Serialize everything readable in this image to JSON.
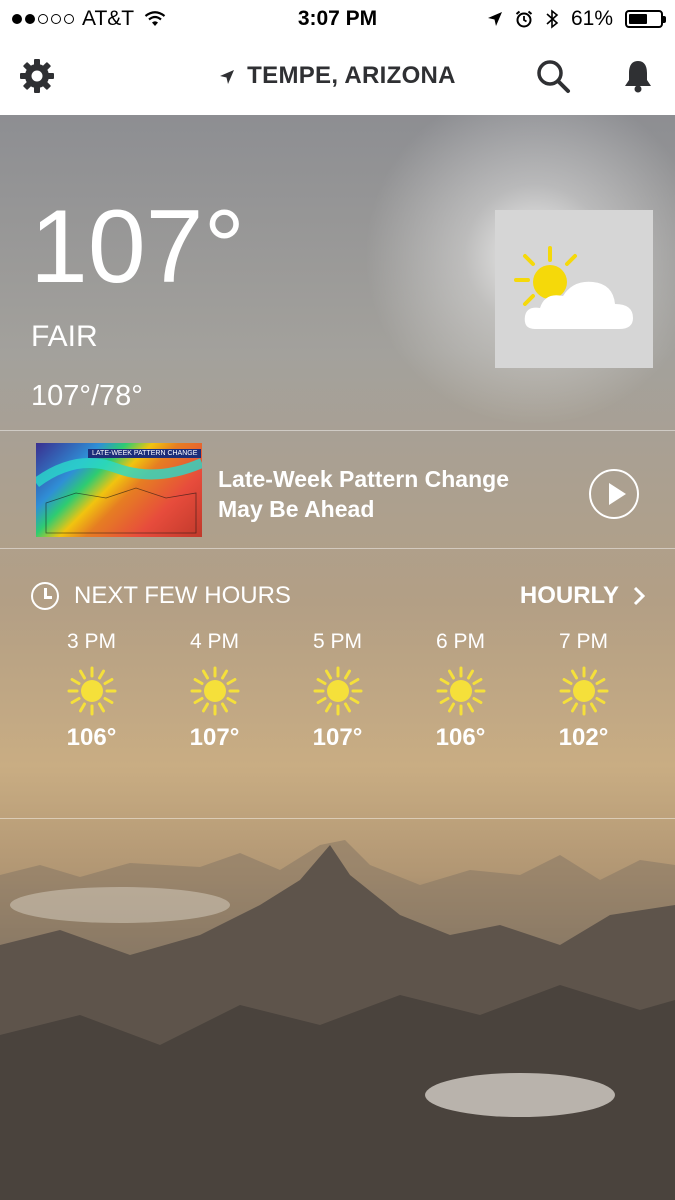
{
  "status_bar": {
    "carrier": "AT&T",
    "time": "3:07 PM",
    "battery": "61%",
    "battery_level": 0.61
  },
  "nav": {
    "location": "TEMPE, ARIZONA"
  },
  "current": {
    "temperature": "107°",
    "condition": "FAIR",
    "hi_lo": "107°/78°",
    "icon": "partly-sunny-icon"
  },
  "video": {
    "title": "Late-Week Pattern Change May Be Ahead",
    "thumbnail_caption": "LATE-WEEK PATTERN CHANGE"
  },
  "forecast": {
    "header": "NEXT FEW HOURS",
    "link": "HOURLY",
    "hours": [
      {
        "time": "3 PM",
        "temp": "106°",
        "icon": "sun-icon"
      },
      {
        "time": "4 PM",
        "temp": "107°",
        "icon": "sun-icon"
      },
      {
        "time": "5 PM",
        "temp": "107°",
        "icon": "sun-icon"
      },
      {
        "time": "6 PM",
        "temp": "106°",
        "icon": "sun-icon"
      },
      {
        "time": "7 PM",
        "temp": "102°",
        "icon": "sun-icon"
      }
    ]
  },
  "colors": {
    "nav_text": "#2f3033",
    "sun": "#f5e03a"
  }
}
